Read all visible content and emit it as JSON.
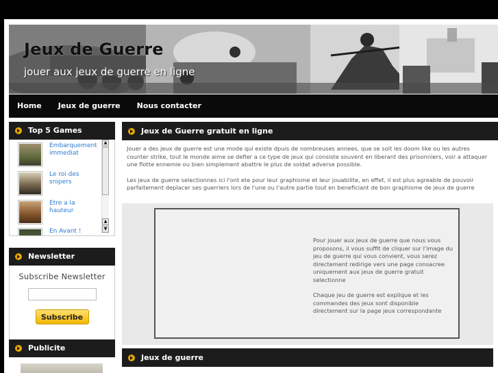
{
  "site": {
    "title": "Jeux de Guerre",
    "tagline": "jouer aux jeux de guerre en ligne"
  },
  "nav": {
    "items": [
      "Home",
      "Jeux de guerre",
      "Nous contacter"
    ]
  },
  "sidebar": {
    "games": {
      "title": "Top 5 Games",
      "items": [
        {
          "label": "Embarquement immediat"
        },
        {
          "label": "Le roi des snipers"
        },
        {
          "label": "Etre a la hauteur"
        },
        {
          "label": "En Avant !"
        }
      ]
    },
    "newsletter": {
      "title": "Newsletter",
      "heading": "Subscribe Newsletter",
      "input_value": "",
      "button_label": "Subscribe"
    },
    "pub": {
      "title": "Publicite"
    }
  },
  "main": {
    "intro_title": "Jeux de Guerre gratuit en ligne",
    "intro_paragraphs": [
      "Jouer a des jeux de guerre est une mode qui existe dpuis de nombreuses annees, que se soit les doom like ou les autres counter strike, tout le monde aime se defier a ce type de jeux qui consiste souvent en liberant des prisonniers, voir a attaquer une flotte ennemie ou bien simplement abattre le plus de soldat adverse possible.",
      "Les jeux de guerre selectionnes ici l'ont ete pour leur graphisme et leur jouabilite, en effet, il est plus agreable de pouvoir parfaitement deplacer ses guerriers lors de l'une ou l'autre partie tout en beneficiant de bon graphisme de jeux de guerre"
    ],
    "feature_paragraphs": [
      "Pour jouer aux jeux de guerre que nous vous proposons, il vous suffit de cliquer sur l'image du jeu de guerre qui vous convient, vous serez directement redirige vers une page consacree uniquement aux jeux de guerre gratuit selectionne",
      "Chaque jeu de guerre est explique et les commandes des jeux sont disponible directement sur la page jeux correspondante"
    ],
    "games_title": "Jeux de guerre"
  },
  "colors": {
    "accent": "#e8a800",
    "header_bar": "#1c1c1c",
    "link": "#2a7bd0"
  }
}
